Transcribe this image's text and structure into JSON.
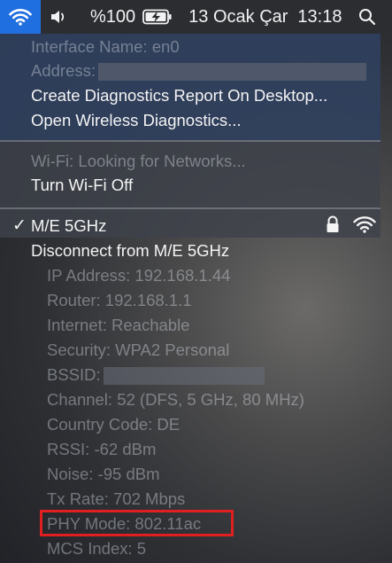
{
  "menubar": {
    "battery_percent": "%100",
    "date": "13 Ocak Çar",
    "time": "13:18"
  },
  "menu": {
    "interface_name": "Interface Name: en0",
    "address_label": "Address:",
    "create_report": "Create Diagnostics Report On Desktop...",
    "open_diagnostics": "Open Wireless Diagnostics...",
    "wifi_status": "Wi-Fi: Looking for Networks...",
    "turn_off": "Turn Wi-Fi Off",
    "network": {
      "checkmark": "✓",
      "name": "M/E 5GHz",
      "disconnect": "Disconnect from M/E 5GHz",
      "details": [
        "IP Address: 192.168.1.44",
        "Router: 192.168.1.1",
        "Internet: Reachable",
        "Security: WPA2 Personal",
        "BSSID:",
        "Channel: 52 (DFS, 5 GHz, 80 MHz)",
        "Country Code: DE",
        "RSSI: -62 dBm",
        "Noise: -95 dBm",
        "Tx Rate: 702 Mbps",
        "PHY Mode: 802.11ac",
        "MCS Index: 5"
      ]
    }
  },
  "colors": {
    "wifi_tile": "#1f6fe0",
    "highlight": "#e02020"
  }
}
